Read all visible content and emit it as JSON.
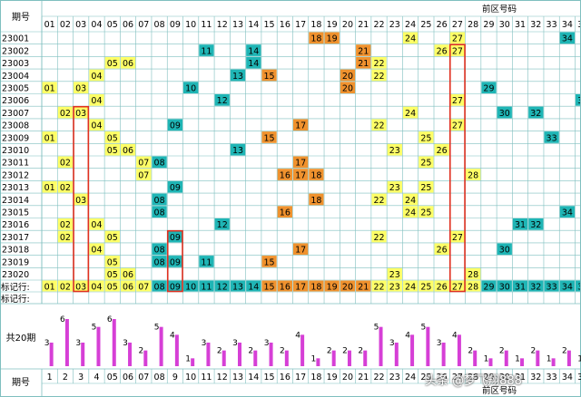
{
  "header": {
    "issue_label": "期号",
    "zone_label": "前区号码"
  },
  "footer": {
    "issue_label": "期号",
    "zone_label": "前区号码",
    "count_label": "共20期"
  },
  "mark_row_labels": [
    "标记行:",
    "标记行:"
  ],
  "watermark": "头条 @梦飞翔888",
  "colors": {
    "yellow": "#ffff66",
    "teal": "#1fb5b5",
    "orange": "#f0922e",
    "red_box": "#e03020",
    "bar": "#d63fd6",
    "grid": "#7fbfbf"
  },
  "chart_data": {
    "type": "table",
    "columns": [
      "01",
      "02",
      "03",
      "04",
      "05",
      "06",
      "07",
      "08",
      "09",
      "10",
      "11",
      "12",
      "13",
      "14",
      "15",
      "16",
      "17",
      "18",
      "19",
      "20",
      "21",
      "22",
      "23",
      "24",
      "25",
      "26",
      "27",
      "28",
      "29",
      "30",
      "31",
      "32",
      "33",
      "34",
      "35"
    ],
    "rows": [
      {
        "issue": "23001",
        "cells": [
          {
            "n": 18,
            "c": "orange"
          },
          {
            "n": 19,
            "c": "orange"
          },
          {
            "n": 24,
            "c": "yellow"
          },
          {
            "n": 27,
            "c": "yellow"
          },
          {
            "n": 34,
            "c": "teal"
          }
        ]
      },
      {
        "issue": "23002",
        "cells": [
          {
            "n": 11,
            "c": "teal"
          },
          {
            "n": 14,
            "c": "teal"
          },
          {
            "n": 21,
            "c": "orange"
          },
          {
            "n": 26,
            "c": "yellow"
          },
          {
            "n": 27,
            "c": "yellow"
          }
        ]
      },
      {
        "issue": "23003",
        "cells": [
          {
            "n": 5,
            "c": "yellow"
          },
          {
            "n": 6,
            "c": "yellow"
          },
          {
            "n": 14,
            "c": "teal"
          },
          {
            "n": 21,
            "c": "orange"
          },
          {
            "n": 22,
            "c": "yellow"
          }
        ]
      },
      {
        "issue": "23004",
        "cells": [
          {
            "n": 4,
            "c": "yellow"
          },
          {
            "n": 13,
            "c": "teal"
          },
          {
            "n": 15,
            "c": "orange"
          },
          {
            "n": 20,
            "c": "orange"
          },
          {
            "n": 22,
            "c": "yellow"
          }
        ]
      },
      {
        "issue": "23005",
        "cells": [
          {
            "n": 1,
            "c": "yellow"
          },
          {
            "n": 3,
            "c": "yellow"
          },
          {
            "n": 10,
            "c": "teal"
          },
          {
            "n": 20,
            "c": "orange"
          },
          {
            "n": 29,
            "c": "teal"
          }
        ]
      },
      {
        "issue": "23006",
        "cells": [
          {
            "n": 4,
            "c": "yellow"
          },
          {
            "n": 12,
            "c": "teal"
          },
          {
            "n": 27,
            "c": "yellow"
          },
          {
            "n": 35,
            "c": "teal"
          }
        ]
      },
      {
        "issue": "23007",
        "cells": [
          {
            "n": 2,
            "c": "yellow"
          },
          {
            "n": 3,
            "c": "yellow"
          },
          {
            "n": 24,
            "c": "yellow"
          },
          {
            "n": 30,
            "c": "teal"
          },
          {
            "n": 32,
            "c": "teal"
          }
        ]
      },
      {
        "issue": "23008",
        "cells": [
          {
            "n": 4,
            "c": "yellow"
          },
          {
            "n": 9,
            "c": "teal"
          },
          {
            "n": 17,
            "c": "orange"
          },
          {
            "n": 22,
            "c": "yellow"
          },
          {
            "n": 27,
            "c": "yellow"
          }
        ]
      },
      {
        "issue": "23009",
        "cells": [
          {
            "n": 1,
            "c": "yellow"
          },
          {
            "n": 5,
            "c": "yellow"
          },
          {
            "n": 15,
            "c": "orange"
          },
          {
            "n": 25,
            "c": "yellow"
          },
          {
            "n": 33,
            "c": "teal"
          }
        ]
      },
      {
        "issue": "23010",
        "cells": [
          {
            "n": 5,
            "c": "yellow"
          },
          {
            "n": 6,
            "c": "yellow"
          },
          {
            "n": 13,
            "c": "teal"
          },
          {
            "n": 23,
            "c": "yellow"
          },
          {
            "n": 26,
            "c": "yellow"
          }
        ]
      },
      {
        "issue": "23011",
        "cells": [
          {
            "n": 2,
            "c": "yellow"
          },
          {
            "n": 7,
            "c": "yellow"
          },
          {
            "n": 8,
            "c": "teal"
          },
          {
            "n": 17,
            "c": "orange"
          },
          {
            "n": 25,
            "c": "yellow"
          }
        ]
      },
      {
        "issue": "23012",
        "cells": [
          {
            "n": 7,
            "c": "yellow"
          },
          {
            "n": 16,
            "c": "orange"
          },
          {
            "n": 17,
            "c": "orange"
          },
          {
            "n": 18,
            "c": "orange"
          },
          {
            "n": 28,
            "c": "yellow"
          }
        ]
      },
      {
        "issue": "23013",
        "cells": [
          {
            "n": 1,
            "c": "yellow"
          },
          {
            "n": 2,
            "c": "yellow"
          },
          {
            "n": 9,
            "c": "teal"
          },
          {
            "n": 23,
            "c": "yellow"
          },
          {
            "n": 25,
            "c": "yellow"
          }
        ]
      },
      {
        "issue": "23014",
        "cells": [
          {
            "n": 3,
            "c": "yellow"
          },
          {
            "n": 8,
            "c": "teal"
          },
          {
            "n": 18,
            "c": "orange"
          },
          {
            "n": 22,
            "c": "yellow"
          },
          {
            "n": 24,
            "c": "yellow"
          }
        ]
      },
      {
        "issue": "23015",
        "cells": [
          {
            "n": 8,
            "c": "teal"
          },
          {
            "n": 16,
            "c": "orange"
          },
          {
            "n": 24,
            "c": "yellow"
          },
          {
            "n": 25,
            "c": "yellow"
          },
          {
            "n": 34,
            "c": "teal"
          }
        ]
      },
      {
        "issue": "23016",
        "cells": [
          {
            "n": 2,
            "c": "yellow"
          },
          {
            "n": 4,
            "c": "yellow"
          },
          {
            "n": 12,
            "c": "teal"
          },
          {
            "n": 31,
            "c": "teal"
          },
          {
            "n": 32,
            "c": "teal"
          }
        ]
      },
      {
        "issue": "23017",
        "cells": [
          {
            "n": 2,
            "c": "yellow"
          },
          {
            "n": 5,
            "c": "yellow"
          },
          {
            "n": 9,
            "c": "teal"
          },
          {
            "n": 22,
            "c": "yellow"
          },
          {
            "n": 27,
            "c": "yellow"
          }
        ]
      },
      {
        "issue": "23018",
        "cells": [
          {
            "n": 4,
            "c": "yellow"
          },
          {
            "n": 8,
            "c": "teal"
          },
          {
            "n": 17,
            "c": "orange"
          },
          {
            "n": 26,
            "c": "yellow"
          },
          {
            "n": 30,
            "c": "teal"
          }
        ]
      },
      {
        "issue": "23019",
        "cells": [
          {
            "n": 5,
            "c": "yellow"
          },
          {
            "n": 8,
            "c": "teal"
          },
          {
            "n": 9,
            "c": "teal"
          },
          {
            "n": 11,
            "c": "teal"
          },
          {
            "n": 15,
            "c": "orange"
          }
        ]
      },
      {
        "issue": "23020",
        "cells": [
          {
            "n": 5,
            "c": "yellow"
          },
          {
            "n": 6,
            "c": "yellow"
          },
          {
            "n": 23,
            "c": "yellow"
          },
          {
            "n": 28,
            "c": "yellow"
          }
        ]
      }
    ],
    "mark_row": [
      {
        "n": "01",
        "c": "yellow"
      },
      {
        "n": "02",
        "c": "yellow"
      },
      {
        "n": "03",
        "c": "yellow"
      },
      {
        "n": "04",
        "c": "yellow"
      },
      {
        "n": "05",
        "c": "yellow"
      },
      {
        "n": "06",
        "c": "yellow"
      },
      {
        "n": "07",
        "c": "yellow"
      },
      {
        "n": "08",
        "c": "teal"
      },
      {
        "n": "09",
        "c": "teal"
      },
      {
        "n": "10",
        "c": "teal"
      },
      {
        "n": "11",
        "c": "teal"
      },
      {
        "n": "12",
        "c": "teal"
      },
      {
        "n": "13",
        "c": "teal"
      },
      {
        "n": "14",
        "c": "teal"
      },
      {
        "n": "15",
        "c": "orange"
      },
      {
        "n": "16",
        "c": "orange"
      },
      {
        "n": "17",
        "c": "orange"
      },
      {
        "n": "18",
        "c": "orange"
      },
      {
        "n": "19",
        "c": "orange"
      },
      {
        "n": "20",
        "c": "orange"
      },
      {
        "n": "21",
        "c": "orange"
      },
      {
        "n": "22",
        "c": "yellow"
      },
      {
        "n": "23",
        "c": "yellow"
      },
      {
        "n": "24",
        "c": "yellow"
      },
      {
        "n": "25",
        "c": "yellow"
      },
      {
        "n": "26",
        "c": "yellow"
      },
      {
        "n": "27",
        "c": "yellow"
      },
      {
        "n": "28",
        "c": "yellow"
      },
      {
        "n": "29",
        "c": "teal"
      },
      {
        "n": "30",
        "c": "teal"
      },
      {
        "n": "31",
        "c": "teal"
      },
      {
        "n": "32",
        "c": "teal"
      },
      {
        "n": "33",
        "c": "teal"
      },
      {
        "n": "34",
        "c": "teal"
      },
      {
        "n": "35",
        "c": "teal"
      }
    ],
    "counts": [
      3,
      6,
      3,
      5,
      6,
      3,
      2,
      5,
      4,
      1,
      3,
      2,
      3,
      2,
      3,
      2,
      4,
      1,
      2,
      2,
      2,
      5,
      3,
      4,
      5,
      3,
      4,
      2,
      1,
      2,
      1,
      2,
      1,
      2,
      1
    ],
    "footer_ticks": [
      "1",
      "2",
      "3",
      "4",
      "05",
      "06",
      "07",
      "08",
      "9",
      "10",
      "11",
      "12",
      "13",
      "14",
      "15",
      "16",
      "17",
      "18",
      "19",
      "20",
      "21",
      "22",
      "23",
      "24",
      "25",
      "26",
      "27",
      "28",
      "29",
      "30",
      "31",
      "32",
      "33",
      "34",
      "35"
    ],
    "red_boxes": [
      {
        "col_from": "03",
        "col_to": "03",
        "issue_from": "23007",
        "issue_to": "23021"
      },
      {
        "col_from": "09",
        "col_to": "09",
        "issue_from": "23017",
        "issue_to": "23021"
      },
      {
        "col_from": "27",
        "col_to": "27",
        "issue_from": "23002",
        "issue_to": "23021"
      }
    ]
  }
}
